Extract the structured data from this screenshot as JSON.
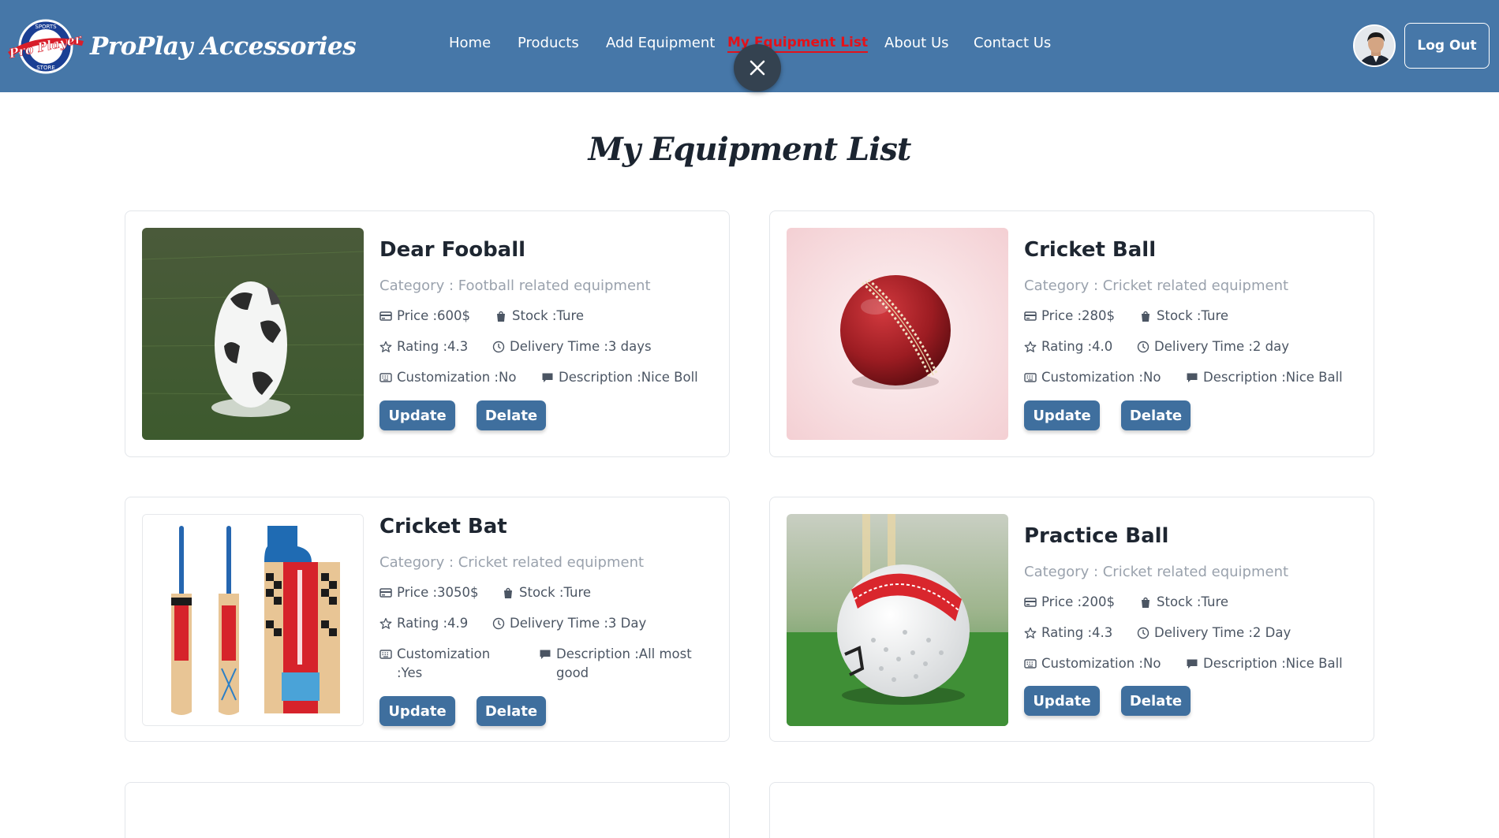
{
  "brand": {
    "name": "ProPlay Accessories",
    "logo_text": "Pro Player",
    "logo_ring_top": "SPORTS",
    "logo_ring_bottom": "STORE"
  },
  "nav": {
    "links": [
      {
        "label": "Home"
      },
      {
        "label": "Products"
      },
      {
        "label": "Add Equipment"
      },
      {
        "label": "My Equipment List",
        "active": true
      },
      {
        "label": "About Us"
      },
      {
        "label": "Contact Us"
      }
    ],
    "logout_label": "Log Out",
    "close_icon": "close-icon"
  },
  "page": {
    "title": "My Equipment List"
  },
  "products": [
    {
      "name": "Dear Fooball",
      "image": "football",
      "category": "Category : Football related equipment",
      "price": "Price :600$",
      "stock": "Stock :Ture",
      "rating": "Rating :4.3",
      "delivery": "Delivery Time :3 days",
      "customization": "Customization :No",
      "description": "Description :Nice Boll",
      "update_label": "Update",
      "delete_label": "Delate"
    },
    {
      "name": "Cricket Ball",
      "image": "cricket-ball",
      "category": "Category : Cricket related equipment",
      "price": "Price :280$",
      "stock": "Stock :Ture",
      "rating": "Rating :4.0",
      "delivery": "Delivery Time :2 day",
      "customization": "Customization :No",
      "description": "Description :Nice Ball",
      "update_label": "Update",
      "delete_label": "Delate"
    },
    {
      "name": "Cricket Bat",
      "image": "cricket-bat",
      "category": "Category : Cricket related equipment",
      "price": "Price :3050$",
      "stock": "Stock :Ture",
      "rating": "Rating :4.9",
      "delivery": "Delivery Time :3 Day",
      "customization": "Customization :Yes",
      "description": "Description :All most good",
      "update_label": "Update",
      "delete_label": "Delate"
    },
    {
      "name": "Practice Ball",
      "image": "practice-ball",
      "category": "Category : Cricket related equipment",
      "price": "Price :200$",
      "stock": "Stock :Ture",
      "rating": "Rating :4.3",
      "delivery": "Delivery Time :2 Day",
      "customization": "Customization :No",
      "description": "Description :Nice Ball",
      "update_label": "Update",
      "delete_label": "Delate"
    }
  ],
  "icons": {
    "price": "credit-card-icon",
    "stock": "shopping-bag-icon",
    "rating": "star-icon",
    "delivery": "clock-icon",
    "customization": "keyboard-icon",
    "description": "comment-icon"
  },
  "colors": {
    "header_bg": "#4677a8",
    "active_link": "#e3121a",
    "button_bg": "#3f6f9e",
    "close_fab": "#344250"
  }
}
